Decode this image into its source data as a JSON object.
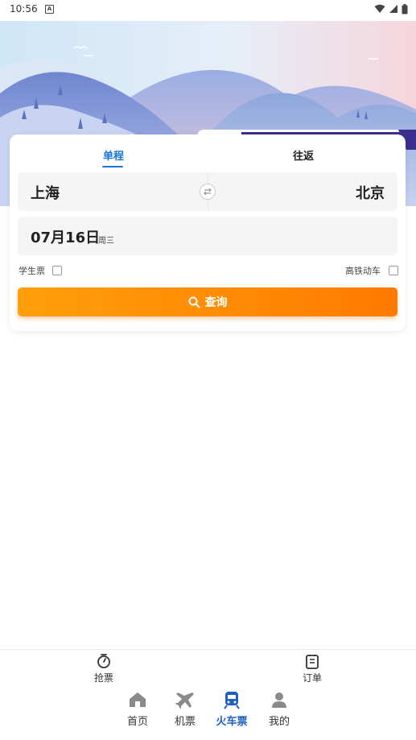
{
  "status": {
    "time": "10:56",
    "a_icon": "A"
  },
  "tabs": {
    "oneway": "单程",
    "roundtrip": "往返"
  },
  "route": {
    "from": "上海",
    "to": "北京"
  },
  "date": {
    "value": "07月16日",
    "weekday": "周三"
  },
  "options": {
    "student": "学生票",
    "highspeed": "高铁动车"
  },
  "search": {
    "label": "查询"
  },
  "subbar": {
    "grab": "抢票",
    "orders": "订单"
  },
  "nav": {
    "home": "首页",
    "flight": "机票",
    "train": "火车票",
    "mine": "我的"
  },
  "colors": {
    "accent": "#1677d2",
    "button_start": "#ff9f0a",
    "button_end": "#ff7a00",
    "nav_active": "#1f5fbf"
  }
}
